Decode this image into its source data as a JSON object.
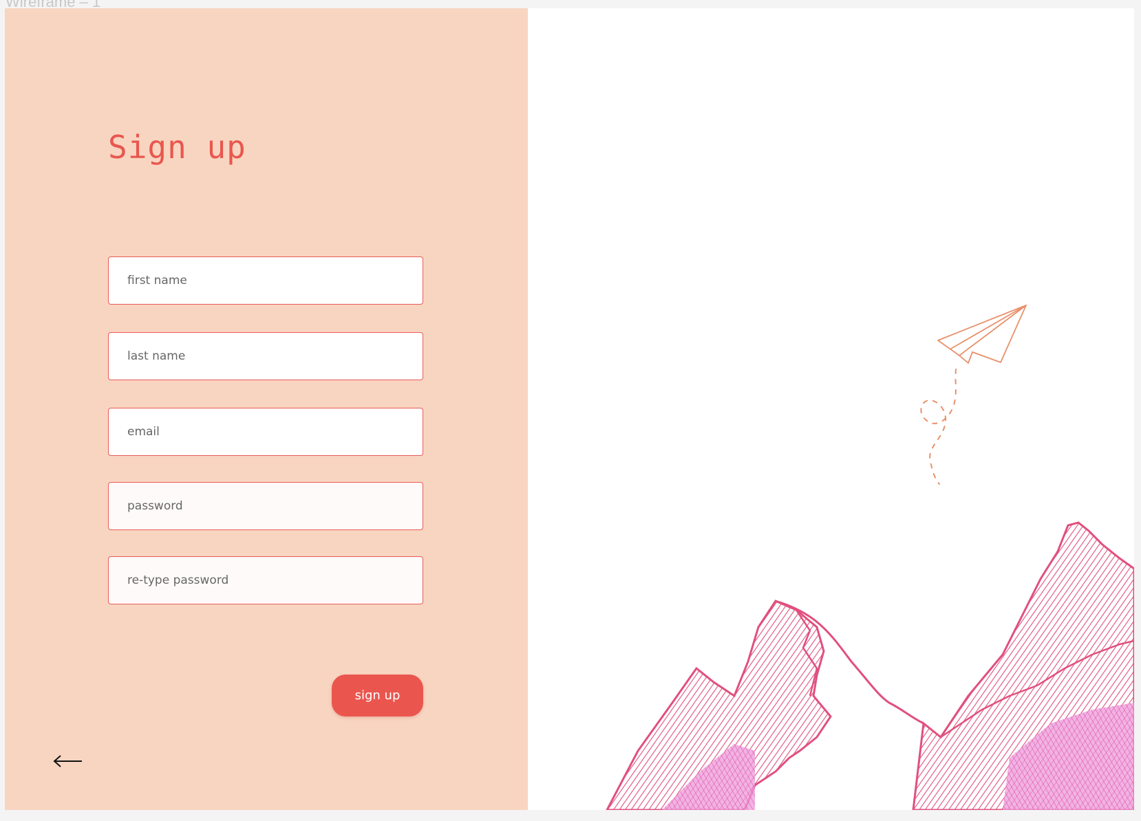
{
  "frame": {
    "label": "Wireframe – 1"
  },
  "signup": {
    "title": "Sign up",
    "fields": {
      "first_name": "first name",
      "last_name": "last name",
      "email": "email",
      "password": "password",
      "retype_password": "re-type password"
    },
    "submit_label": "sign up"
  },
  "icons": {
    "back": "arrow-left-icon",
    "plane": "paper-plane-icon",
    "mountains": "mountains-illustration"
  },
  "colors": {
    "panel_bg": "#f8d5c1",
    "accent": "#e8574f",
    "plane": "#e8906a",
    "mountain": "#e0507e",
    "mountain_shade": "#e88ad8"
  }
}
